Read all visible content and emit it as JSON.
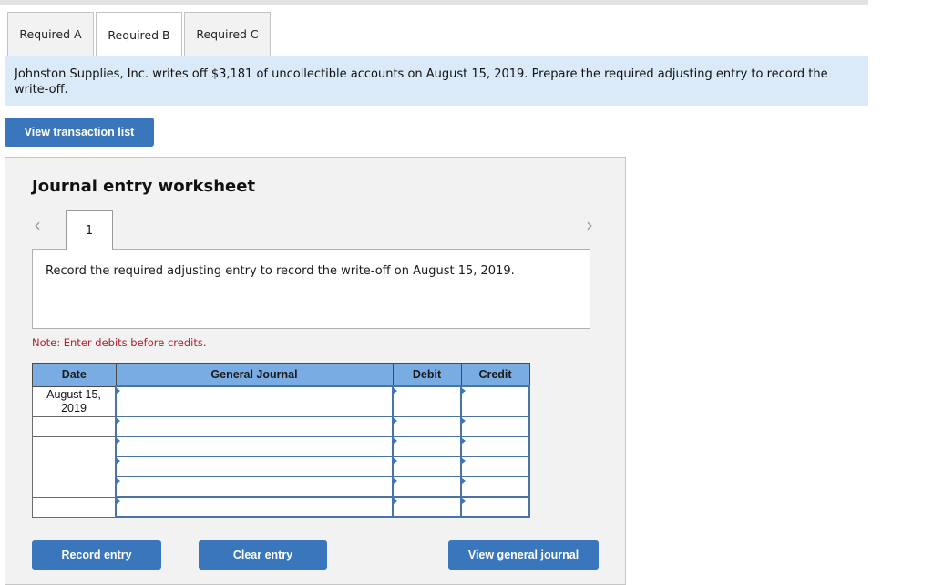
{
  "tabs": [
    {
      "label": "Required A",
      "active": false
    },
    {
      "label": "Required B",
      "active": true
    },
    {
      "label": "Required C",
      "active": false
    }
  ],
  "question": {
    "text": "Johnston Supplies, Inc. writes off $3,181 of uncollectible accounts on August 15, 2019. Prepare the required adjusting entry to record the write-off."
  },
  "buttons": {
    "view_transaction_list": "View transaction list",
    "record_entry": "Record entry",
    "clear_entry": "Clear entry",
    "view_general_journal": "View general journal"
  },
  "worksheet": {
    "title": "Journal entry worksheet",
    "prev_icon": "‹",
    "next_icon": "›",
    "entry_number": "1",
    "instruction": "Record the required adjusting entry to record the write-off on August 15, 2019.",
    "note": "Note: Enter debits before credits."
  },
  "journal": {
    "headers": {
      "date": "Date",
      "general_journal": "General Journal",
      "debit": "Debit",
      "credit": "Credit"
    },
    "rows": [
      {
        "date": "August 15, 2019",
        "account": "",
        "debit": "",
        "credit": ""
      },
      {
        "date": "",
        "account": "",
        "debit": "",
        "credit": ""
      },
      {
        "date": "",
        "account": "",
        "debit": "",
        "credit": ""
      },
      {
        "date": "",
        "account": "",
        "debit": "",
        "credit": ""
      },
      {
        "date": "",
        "account": "",
        "debit": "",
        "credit": ""
      },
      {
        "date": "",
        "account": "",
        "debit": "",
        "credit": ""
      }
    ]
  },
  "colors": {
    "accent": "#3a76bb",
    "header_blue": "#78ace2",
    "question_bg": "#daeaf8",
    "note_red": "#b0232a"
  }
}
